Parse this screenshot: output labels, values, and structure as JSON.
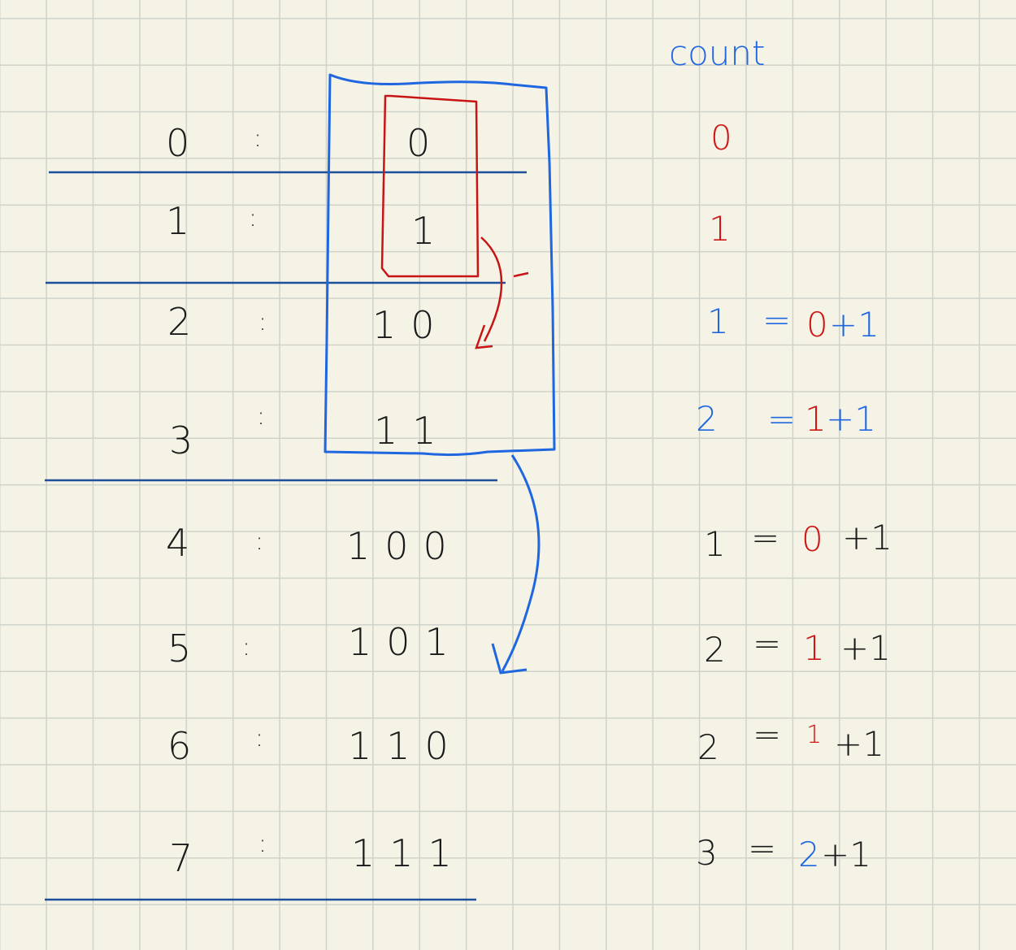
{
  "header": {
    "count_label": "count"
  },
  "rows": [
    {
      "decimal": "0",
      "colon": ":",
      "binary": "0"
    },
    {
      "decimal": "1",
      "colon": ":",
      "binary": "1"
    },
    {
      "decimal": "2",
      "colon": ":",
      "binary": "10"
    },
    {
      "decimal": "3",
      "colon": ":",
      "binary": "11"
    },
    {
      "decimal": "4",
      "colon": ":",
      "binary": "100"
    },
    {
      "decimal": "5",
      "colon": ":",
      "binary": "101"
    },
    {
      "decimal": "6",
      "colon": ":",
      "binary": "110"
    },
    {
      "decimal": "7",
      "colon": ":",
      "binary": "111"
    }
  ],
  "counts": [
    {
      "count": "0"
    },
    {
      "count": "1"
    },
    {
      "count": "1",
      "eq": "=",
      "prev": "0",
      "plus": "+1"
    },
    {
      "count": "2",
      "eq": "=",
      "prev": "1",
      "plus": "+1"
    },
    {
      "count": "1",
      "eq": "=",
      "prev": "0",
      "plus": "+1"
    },
    {
      "count": "2",
      "eq": "=",
      "prev": "1",
      "plus": "+1"
    },
    {
      "count": "2",
      "eq": "=",
      "prev": "1",
      "plus": "+1"
    },
    {
      "count": "3",
      "eq": "=",
      "prev": "2",
      "plus": "+1"
    }
  ],
  "colors": {
    "blue": "#1f66e0",
    "red": "#d01515",
    "navy": "#1d4f9a",
    "ink": "#1a1a1a",
    "paper": "#f4f3e6",
    "grid": "#cfd3c9"
  }
}
